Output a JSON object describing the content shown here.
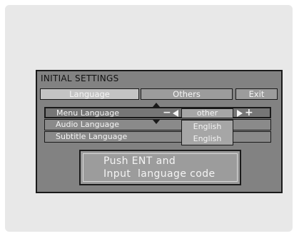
{
  "window": {
    "title": "INITIAL SETTINGS"
  },
  "tabs": [
    {
      "label": "Language",
      "active": true
    },
    {
      "label": "Others",
      "active": false
    },
    {
      "label": "Exit",
      "active": false
    }
  ],
  "rows": [
    {
      "label": "Menu Language",
      "selected": true
    },
    {
      "label": "Audio Language",
      "selected": false
    },
    {
      "label": "Subtitle Language",
      "selected": false
    }
  ],
  "menu_language": {
    "value": "other",
    "decrease_symbol": "−",
    "increase_symbol": "+"
  },
  "dropdown": {
    "options": [
      "English",
      "English"
    ]
  },
  "message": {
    "line1": "Push ENT and",
    "line2": "Input  language code"
  }
}
